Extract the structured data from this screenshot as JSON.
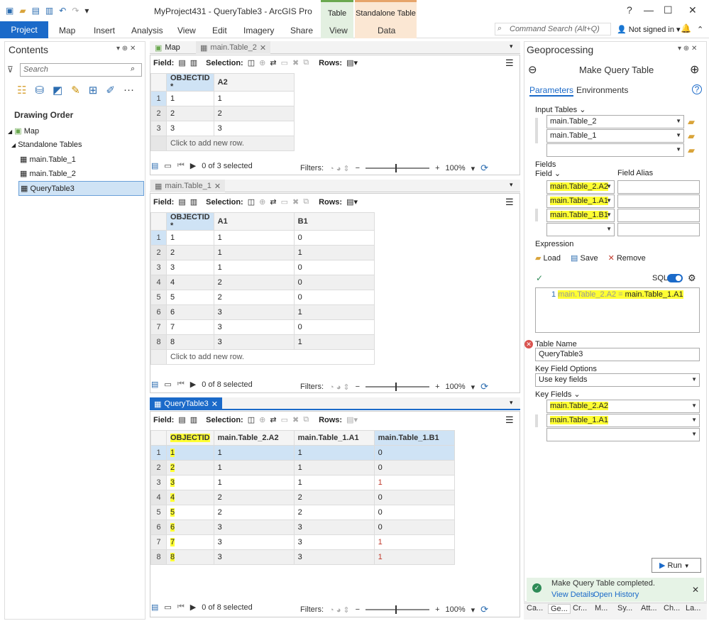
{
  "window": {
    "title": "MyProject431 - QueryTable3 - ArcGIS Pro",
    "min": "—",
    "max": "☐",
    "close": "✕",
    "help": "?"
  },
  "context_tabs": {
    "table_header": "Table",
    "table_sub": "View",
    "standalone_header": "Standalone Table",
    "standalone_sub": "Data"
  },
  "ribbon": {
    "tabs": [
      "Project",
      "Map",
      "Insert",
      "Analysis",
      "View",
      "Edit",
      "Imagery",
      "Share"
    ],
    "search_placeholder": "Command Search (Alt+Q)",
    "sign_in": "Not signed in ▾",
    "bell": "🔔",
    "chev": "⌃"
  },
  "contents": {
    "title": "Contents",
    "search_placeholder": "Search",
    "drawing_order": "Drawing Order",
    "map": "Map",
    "standalone": "Standalone Tables",
    "tables": [
      "main.Table_1",
      "main.Table_2",
      "QueryTable3"
    ],
    "more": "···"
  },
  "views": {
    "map_tab": "Map",
    "table2_tab": "main.Table_2",
    "table1_tab": "main.Table_1",
    "query_tab": "QueryTable3"
  },
  "toolbar": {
    "field": "Field:",
    "selection": "Selection:",
    "rows": "Rows:"
  },
  "table2": {
    "headers": [
      "OBJECTID *",
      "A2"
    ],
    "rows": [
      [
        "1",
        "1",
        "1"
      ],
      [
        "2",
        "2",
        "2"
      ],
      [
        "3",
        "3",
        "3"
      ]
    ],
    "add": "Click to add new row.",
    "status": "0 of 3 selected",
    "filters": "Filters:",
    "zoom": "100%"
  },
  "table1": {
    "headers": [
      "OBJECTID *",
      "A1",
      "B1"
    ],
    "rows": [
      [
        "1",
        "1",
        "1",
        "0"
      ],
      [
        "2",
        "2",
        "1",
        "1"
      ],
      [
        "3",
        "3",
        "1",
        "0"
      ],
      [
        "4",
        "4",
        "2",
        "0"
      ],
      [
        "5",
        "5",
        "2",
        "0"
      ],
      [
        "6",
        "6",
        "3",
        "1"
      ],
      [
        "7",
        "7",
        "3",
        "0"
      ],
      [
        "8",
        "8",
        "3",
        "1"
      ]
    ],
    "add": "Click to add new row.",
    "status": "0 of 8 selected",
    "filters": "Filters:",
    "zoom": "100%"
  },
  "query": {
    "headers": [
      "OBJECTID",
      "main.Table_2.A2",
      "main.Table_1.A1",
      "main.Table_1.B1"
    ],
    "rows": [
      [
        "1",
        "1",
        "1",
        "1",
        "0"
      ],
      [
        "2",
        "2",
        "1",
        "1",
        "0"
      ],
      [
        "3",
        "3",
        "1",
        "1",
        "1"
      ],
      [
        "4",
        "4",
        "2",
        "2",
        "0"
      ],
      [
        "5",
        "5",
        "2",
        "2",
        "0"
      ],
      [
        "6",
        "6",
        "3",
        "3",
        "0"
      ],
      [
        "7",
        "7",
        "3",
        "3",
        "1"
      ],
      [
        "8",
        "8",
        "3",
        "3",
        "1"
      ]
    ],
    "status": "0 of 8 selected",
    "filters": "Filters:",
    "zoom": "100%"
  },
  "gp": {
    "title": "Geoprocessing",
    "tool": "Make Query Table",
    "tab_params": "Parameters",
    "tab_env": "Environments",
    "input_label": "Input Tables",
    "inputs": [
      "main.Table_2",
      "main.Table_1",
      ""
    ],
    "fields_label": "Fields",
    "field_col": "Field",
    "alias_col": "Field Alias",
    "fields": [
      "main.Table_2.A2",
      "main.Table_1.A1",
      "main.Table_1.B1",
      ""
    ],
    "expr_label": "Expression",
    "load": "Load",
    "save": "Save",
    "remove": "Remove",
    "sql": "SQL",
    "expr_line_no": "1",
    "expr_text": "main.Table_2.A2 = ",
    "expr_text2": "main.Table_1.A1",
    "tname_label": "Table Name",
    "tname": "QueryTable3",
    "kfo_label": "Key Field Options",
    "kfo": "Use key fields",
    "kf_label": "Key Fields",
    "kfields": [
      "main.Table_2.A2",
      "main.Table_1.A1",
      ""
    ],
    "run": "Run",
    "done": "Make Query Table completed.",
    "view_details": "View Details",
    "open_history": "Open History",
    "bottom_tabs": [
      "Ca...",
      "Ge...",
      "Cr...",
      "M...",
      "Sy...",
      "Att...",
      "Ch...",
      "La..."
    ]
  }
}
